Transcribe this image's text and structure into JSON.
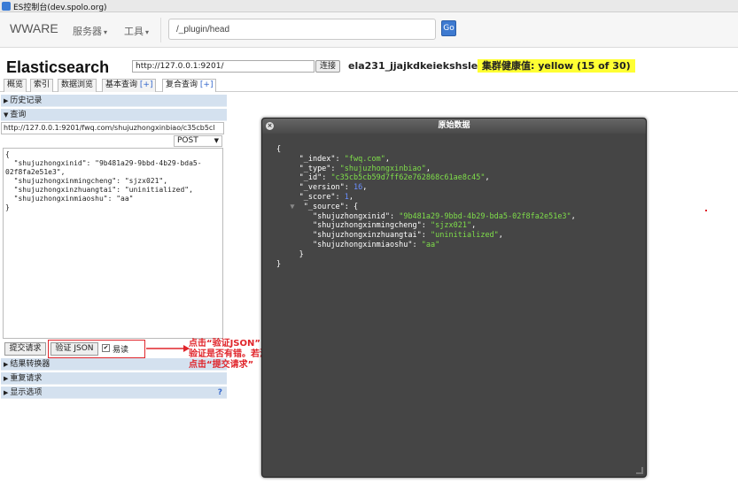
{
  "window": {
    "title": "ES控制台(dev.spolo.org)"
  },
  "navbar": {
    "brand": "WWARE",
    "menu_servers": "服务器",
    "menu_tools": "工具",
    "search_value": "/_plugin/head",
    "go_label": "Go"
  },
  "es": {
    "title": "Elasticsearch",
    "url": "http://127.0.0.1:9201/",
    "connect_label": "连接",
    "cluster_name": "ela231_jjajkdkeiekshslel",
    "health": "集群健康值: yellow (15 of 30)",
    "health_color": "#ffff33"
  },
  "tabs": [
    {
      "label": "概览"
    },
    {
      "label": "索引"
    },
    {
      "label": "数据浏览"
    },
    {
      "label": "基本查询",
      "plus": "[+]"
    },
    {
      "label": "复合查询",
      "plus": "[+]"
    }
  ],
  "left": {
    "history_label": "历史记录",
    "query_label": "查询",
    "query_url": "http://127.0.0.1:9201/fwq.com/shujuzhongxinbiao/c35cb5cl",
    "method": "POST",
    "body": "{\n  \"shujuzhongxinid\": \"9b481a29-9bbd-4b29-bda5-\n02f8fa2e51e3\",\n  \"shujuzhongxinmingcheng\": \"sjzx021\",\n  \"shujuzhongxinzhuangtai\": \"uninitialized\",\n  \"shujuzhongxinmiaoshu\": \"aa\"\n}",
    "submit_label": "提交请求",
    "validate_label": "验证 JSON",
    "pretty_label": "易读",
    "pretty_checked": "✔",
    "result_transformer_label": "结果转换器",
    "repeat_label": "重复请求",
    "display_options_label": "显示选项",
    "help_mark": "?"
  },
  "annotation": {
    "line1": "点击“验证JSON”",
    "line2a": "验证是否有错。",
    "line2b": "若没报错，",
    "line3": "点击“提交请求”",
    "color": "#e0252b"
  },
  "dialog": {
    "title": "原始数据",
    "close": "×",
    "lines": {
      "open": "{",
      "index_k": "\"_index\"",
      "index_v": "\"fwq.com\"",
      "type_k": "\"_type\"",
      "type_v": "\"shujuzhongxinbiao\"",
      "id_k": "\"_id\"",
      "id_v": "\"c35cb5cb59d7ff62e762868c61ae8c45\"",
      "version_k": "\"_version\"",
      "version_v": "16",
      "score_k": "\"_score\"",
      "score_v": "1",
      "source_k": "\"_source\"",
      "s1_k": "\"shujuzhongxinid\"",
      "s1_v": "\"9b481a29-9bbd-4b29-bda5-02f8fa2e51e3\"",
      "s2_k": "\"shujuzhongxinmingcheng\"",
      "s2_v": "\"sjzx021\"",
      "s3_k": "\"shujuzhongxinzhuangtai\"",
      "s3_v": "\"uninitialized\"",
      "s4_k": "\"shujuzhongxinmiaoshu\"",
      "s4_v": "\"aa\""
    },
    "colors": {
      "string": "#7fdf4a",
      "number": "#6a8fff",
      "background": "#454545"
    }
  }
}
